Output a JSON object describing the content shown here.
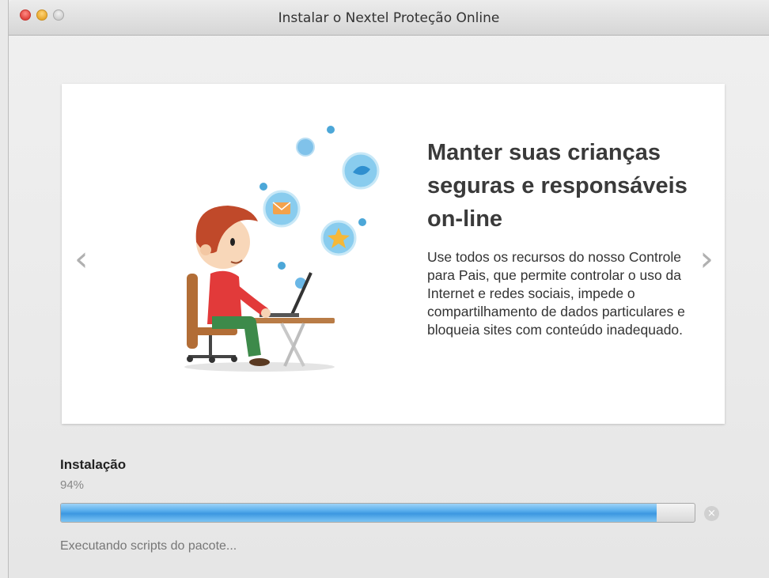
{
  "window": {
    "title": "Instalar o Nextel Proteção Online",
    "buttons": {
      "close_icon": "close-icon",
      "minimize_icon": "minimize-icon",
      "zoom_icon": "zoom-icon"
    }
  },
  "slide": {
    "prev_glyph": "‹",
    "next_glyph": "›",
    "headline": "Manter suas crianças seguras e responsáveis on-line",
    "body": "Use todos os recursos do nosso Controle para Pais, que permite controlar o uso da Internet e redes sociais, impede o compartilhamento de dados particulares e bloqueia sites com conteúdo inadequado."
  },
  "install": {
    "label": "Instalação",
    "percent_text": "94%",
    "progress": 0.94,
    "status": "Executando scripts do pacote...",
    "cancel_glyph": "×"
  },
  "colors": {
    "progress_fill": "#4aa3e8",
    "headline": "#3a3a3a"
  }
}
